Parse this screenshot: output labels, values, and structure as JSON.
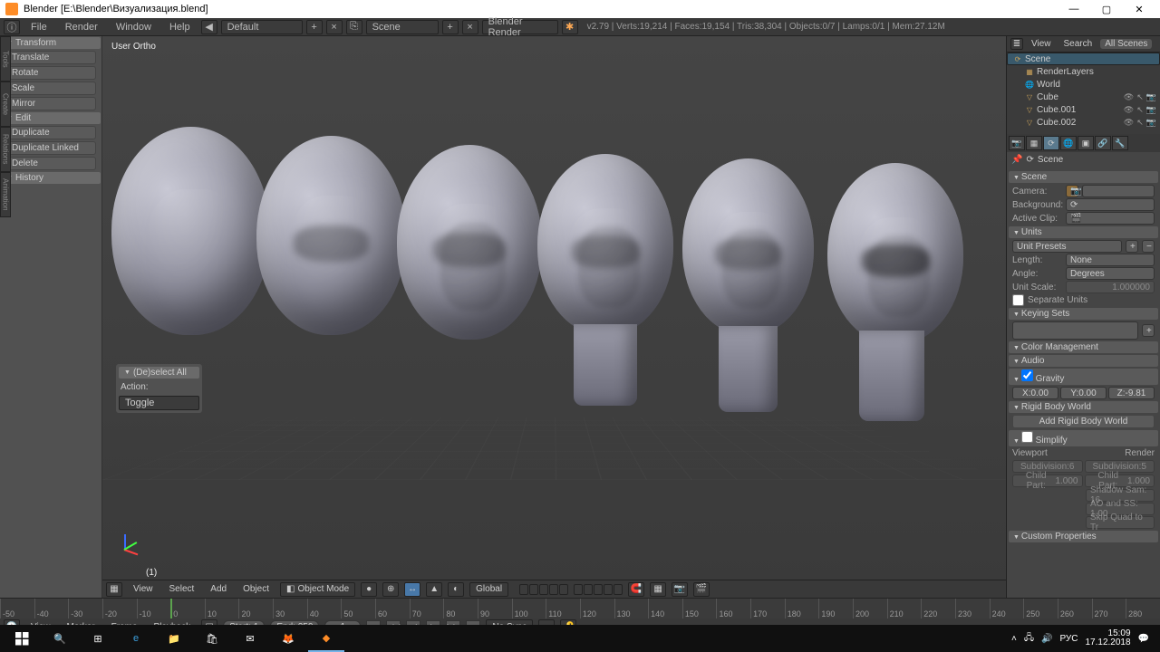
{
  "window": {
    "title": "Blender  [E:\\Blender\\Визуализация.blend]"
  },
  "menus": [
    "File",
    "Render",
    "Window",
    "Help"
  ],
  "top": {
    "layout": "Default",
    "scene": "Scene",
    "engine": "Blender Render",
    "stats": "v2.79 | Verts:19,214 | Faces:19,154 | Tris:38,304 | Objects:0/7 | Lamps:0/1 | Mem:27.12M"
  },
  "left": {
    "transform_h": "Transform",
    "transform": [
      "Translate",
      "Rotate",
      "Scale"
    ],
    "mirror": "Mirror",
    "edit_h": "Edit",
    "edit": [
      "Duplicate",
      "Duplicate Linked",
      "Delete"
    ],
    "history_h": "History"
  },
  "lastaction": {
    "h": "(De)select All",
    "actionLabel": "Action:",
    "actionVal": "Toggle"
  },
  "viewport": {
    "label": "User Ortho",
    "selection": "(1)",
    "header": {
      "view": "View",
      "select": "Select",
      "add": "Add",
      "object": "Object",
      "mode": "Object Mode",
      "orient": "Global"
    }
  },
  "timeline": {
    "ticks": [
      "-50",
      "-40",
      "-30",
      "-20",
      "-10",
      "0",
      "10",
      "20",
      "30",
      "40",
      "50",
      "60",
      "70",
      "80",
      "90",
      "100",
      "110",
      "120",
      "130",
      "140",
      "150",
      "160",
      "170",
      "180",
      "190",
      "200",
      "210",
      "220",
      "230",
      "240",
      "250",
      "260",
      "270",
      "280"
    ],
    "cur_frame": 0,
    "menus": {
      "view": "View",
      "marker": "Marker",
      "frame": "Frame",
      "playback": "Playback"
    },
    "start_l": "Start:",
    "start": 1,
    "end_l": "End:",
    "end": 250,
    "frame": 1,
    "sync": "No Sync"
  },
  "outliner": {
    "tabs": {
      "view": "View",
      "search": "Search",
      "all": "All Scenes"
    },
    "tree": [
      {
        "name": "Scene",
        "icon": "scene",
        "depth": 0,
        "sel": true
      },
      {
        "name": "RenderLayers",
        "icon": "layers",
        "depth": 1
      },
      {
        "name": "World",
        "icon": "world",
        "depth": 1
      },
      {
        "name": "Cube",
        "icon": "mesh",
        "depth": 1,
        "icons": true
      },
      {
        "name": "Cube.001",
        "icon": "mesh",
        "depth": 1,
        "icons": true
      },
      {
        "name": "Cube.002",
        "icon": "mesh",
        "depth": 1,
        "icons": true
      }
    ]
  },
  "props": {
    "scene_crumb": "Scene",
    "scene_h": "Scene",
    "camera_l": "Camera:",
    "camera": "",
    "bg_l": "Background:",
    "bg": "",
    "clip_l": "Active Clip:",
    "clip": "",
    "units_h": "Units",
    "unit_presets": "Unit Presets",
    "len_l": "Length:",
    "len": "None",
    "ang_l": "Angle:",
    "ang": "Degrees",
    "uscale_l": "Unit Scale:",
    "uscale": "1.000000",
    "sepunits": "Separate Units",
    "keying_h": "Keying Sets",
    "colormgmt_h": "Color Management",
    "audio_h": "Audio",
    "grav_h": "Gravity",
    "grav": {
      "x": "0.00",
      "y": "0.00",
      "z": "-9.81"
    },
    "rbw_h": "Rigid Body World",
    "rbw_btn": "Add Rigid Body World",
    "simplify_h": "Simplify",
    "simp": {
      "vp": "Viewport",
      "rd": "Render",
      "sub_l": "Subdivision:",
      "sub_v": "6",
      "sub_r": "5",
      "cp_l": "Child Part:",
      "cp": "1.000",
      "ss": "Shadow Sam: 16",
      "ao": "AO and SS: 1.00",
      "sq": "Skip Quad to Tr"
    },
    "cprops_h": "Custom Properties"
  },
  "tray": {
    "time": "15:09",
    "date": "17.12.2018",
    "lang": "РУС"
  }
}
